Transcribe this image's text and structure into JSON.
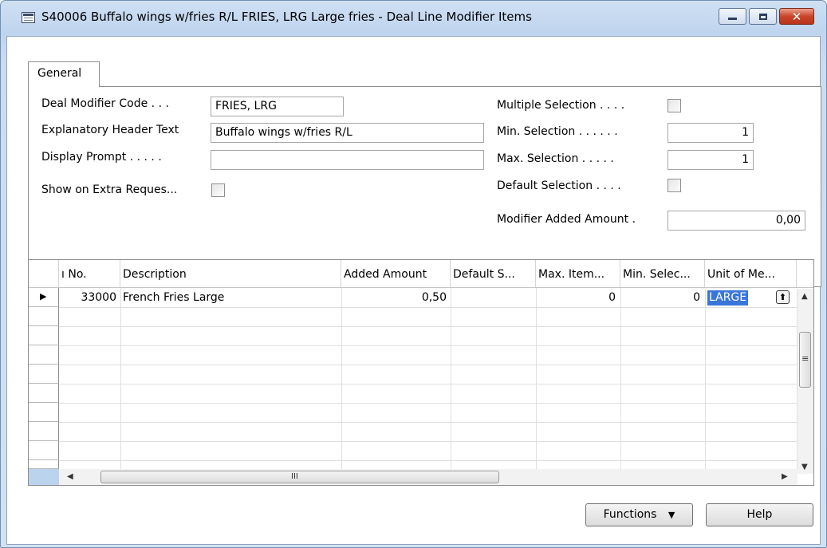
{
  "window": {
    "title": "S40006 Buffalo wings w/fries R/L FRIES, LRG Large fries - Deal Line Modifier Items",
    "icons": {
      "app": "table-icon",
      "minimize": "minimize-icon",
      "maximize": "maximize-icon",
      "close": "close-icon"
    },
    "close_glyph": "✕"
  },
  "tabs": [
    {
      "label": "General"
    }
  ],
  "form": {
    "deal_modifier_code": {
      "label": "Deal Modifier Code . . .",
      "value": "FRIES, LRG"
    },
    "explanatory_header_text": {
      "label": "Explanatory Header Text",
      "value": "Buffalo wings w/fries R/L"
    },
    "display_prompt": {
      "label": "Display Prompt . . . . .",
      "value": ""
    },
    "show_on_extra_request": {
      "label": "Show on Extra Reques...",
      "checked": false
    },
    "multiple_selection": {
      "label": "Multiple Selection . . . .",
      "checked": false
    },
    "min_selection": {
      "label": "Min. Selection . . . . . .",
      "value": "1"
    },
    "max_selection": {
      "label": "Max. Selection . . . . .",
      "value": "1"
    },
    "default_selection": {
      "label": "Default Selection . . . .",
      "checked": false
    },
    "modifier_added_amount": {
      "label": "Modifier Added Amount .",
      "value": "0,00"
    }
  },
  "grid": {
    "columns": [
      "ı No.",
      "Description",
      "Added Amount",
      "Default S...",
      "Max. Item...",
      "Min. Selec...",
      "Unit of Me..."
    ],
    "rows": [
      {
        "no": "33000",
        "description": "French Fries Large",
        "added_amount": "0,50",
        "default_selection": "",
        "max_item": "0",
        "min_selection": "0",
        "unit_of_measure": "LARGE"
      }
    ],
    "row_indicator": "▶",
    "lookup_icon": "up-arrow-lookup-icon",
    "scroll_icons": {
      "up": "▲",
      "down": "▼",
      "left": "◀",
      "right": "▶",
      "grip_v": "≡",
      "grip_h": "III"
    }
  },
  "buttons": {
    "functions": {
      "label": "Functions",
      "icon": "▼"
    },
    "help": {
      "label": "Help"
    }
  }
}
